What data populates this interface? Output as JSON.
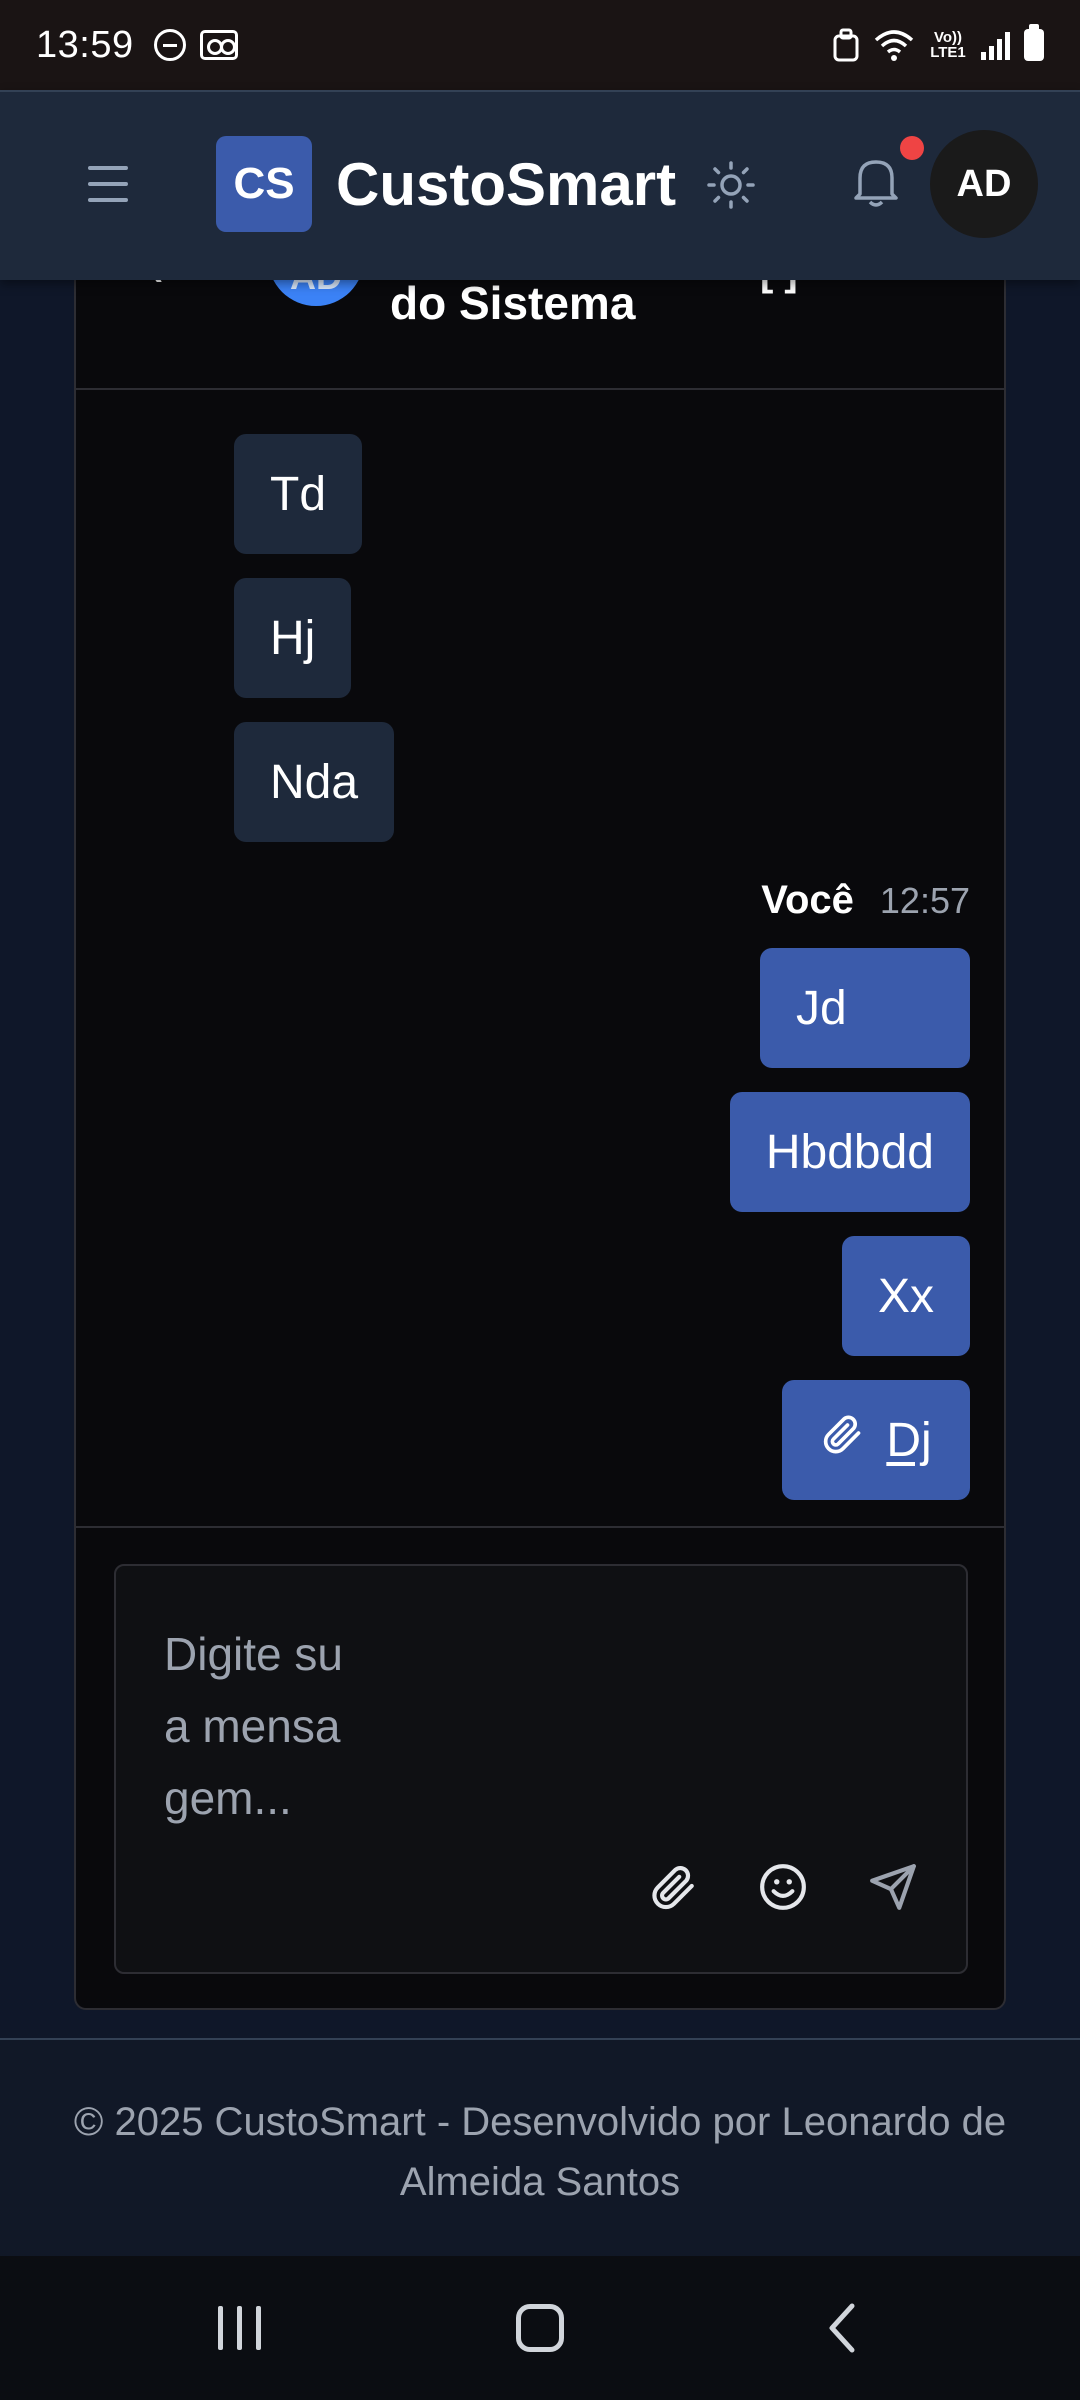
{
  "status_bar": {
    "time": "13:59",
    "network_label": "Vo)) LTE1"
  },
  "header": {
    "logo_initials": "CS",
    "brand": "CustoSmart",
    "avatar_initials": "AD",
    "has_notification": true
  },
  "chat": {
    "partner_avatar_initials": "AD",
    "partner_name_line": "do Sistema",
    "header_fragment_right": "[ ] ·",
    "incoming_messages": [
      "Td",
      "Hj",
      "Nda"
    ],
    "outgoing_sender": "Você",
    "outgoing_time": "12:57",
    "outgoing_messages": [
      "Jd",
      "Hbdbdd",
      "Xx"
    ],
    "outgoing_attachment": "Dj",
    "composer_placeholder": "Digite sua mensagem..."
  },
  "footer": {
    "text": "© 2025 CustoSmart - Desenvolvido por Leonardo de Almeida Santos"
  },
  "colors": {
    "accent": "#3b5bab",
    "incoming_bubble": "#1e293b",
    "notification": "#ef4444"
  }
}
